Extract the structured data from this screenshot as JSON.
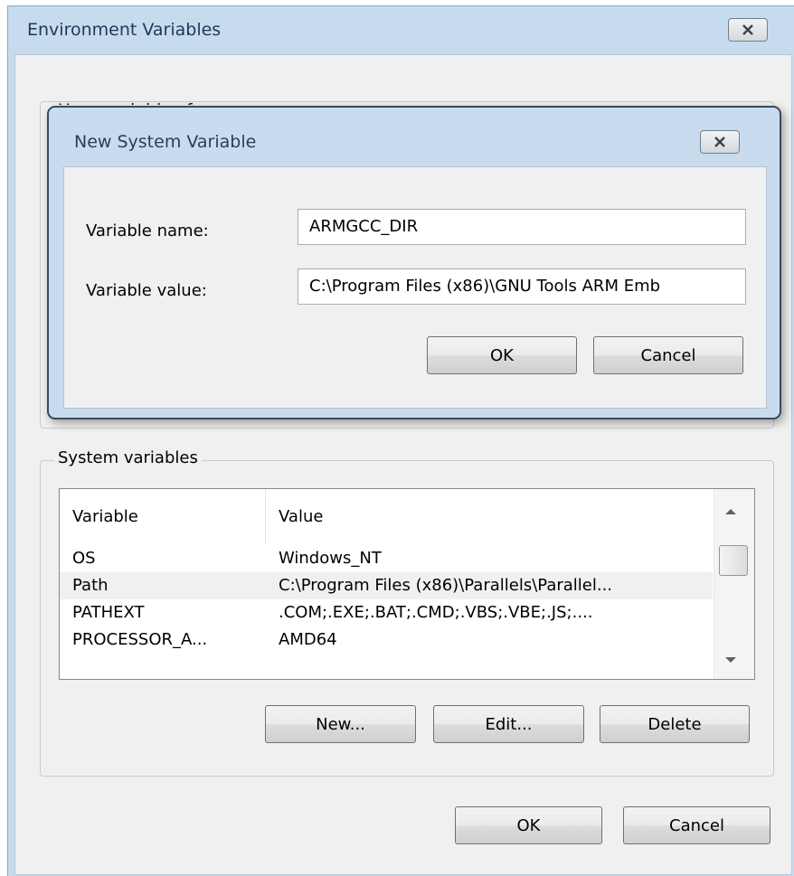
{
  "env_window": {
    "title": "Environment Variables",
    "behind_user_label": "User variables for ",
    "ok_label": "OK",
    "cancel_label": "Cancel"
  },
  "dialog": {
    "title": "New System Variable",
    "name_label": "Variable name:",
    "name_value": "ARMGCC_DIR",
    "value_label": "Variable value:",
    "value_value": "C:\\Program Files (x86)\\GNU Tools ARM Emb",
    "ok_label": "OK",
    "cancel_label": "Cancel"
  },
  "system_vars": {
    "group_label": "System variables",
    "columns": [
      "Variable",
      "Value"
    ],
    "rows": [
      {
        "variable": "OS",
        "value": "Windows_NT"
      },
      {
        "variable": "Path",
        "value": "C:\\Program Files (x86)\\Parallels\\Parallel..."
      },
      {
        "variable": "PATHEXT",
        "value": ".COM;.EXE;.BAT;.CMD;.VBS;.VBE;.JS;...."
      },
      {
        "variable": "PROCESSOR_A...",
        "value": "AMD64"
      }
    ],
    "selected_row": "Path",
    "new_label": "New...",
    "edit_label": "Edit...",
    "delete_label": "Delete"
  },
  "icons": {
    "close": "close-icon",
    "scroll_up": "scroll-up-arrow-icon",
    "scroll_down": "scroll-down-arrow-icon"
  }
}
